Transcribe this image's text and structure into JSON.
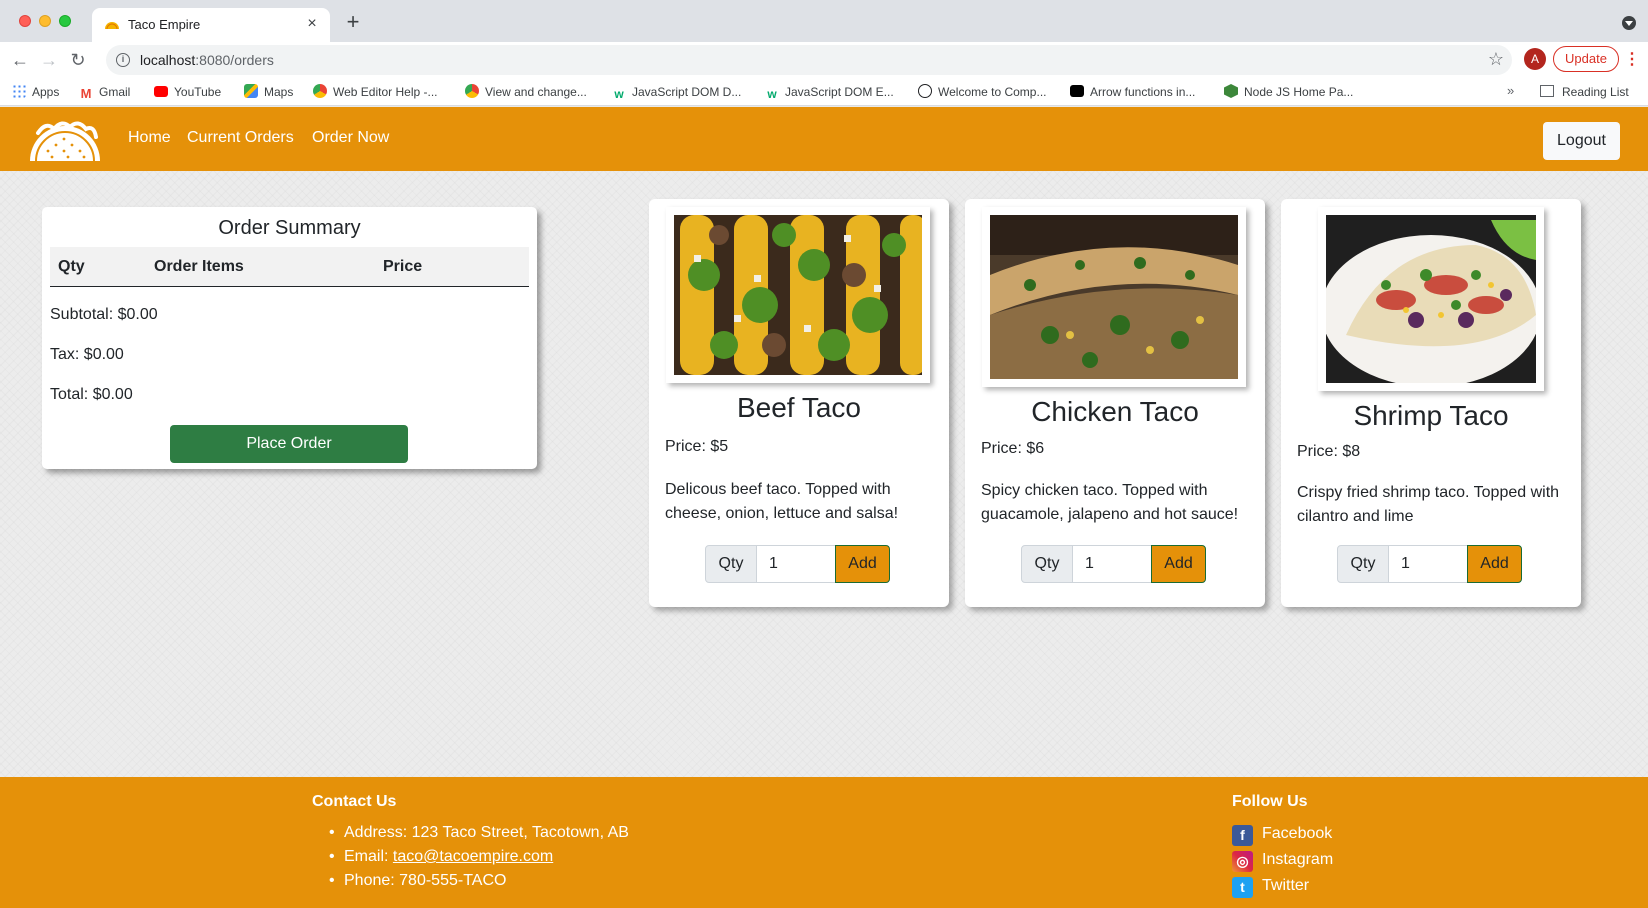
{
  "browser": {
    "tab_title": "Taco Empire",
    "url_host": "localhost",
    "url_rest": ":8080/orders",
    "profile_initial": "A",
    "update_label": "Update",
    "bookmarks": [
      {
        "label": "Apps",
        "icon": "apps-grid-icon",
        "color": "#4285f4"
      },
      {
        "label": "Gmail",
        "icon": "gmail-icon",
        "color": "#ea4335"
      },
      {
        "label": "YouTube",
        "icon": "youtube-icon",
        "color": "#ff0000"
      },
      {
        "label": "Maps",
        "icon": "maps-icon",
        "color": "#34a853"
      },
      {
        "label": "Web Editor Help -...",
        "icon": "chrome-icon",
        "color": "#fbbc05"
      },
      {
        "label": "View and change...",
        "icon": "chrome-icon",
        "color": "#fbbc05"
      },
      {
        "label": "JavaScript DOM D...",
        "icon": "w3-icon",
        "color": "#04aa6d"
      },
      {
        "label": "JavaScript DOM E...",
        "icon": "w3-icon",
        "color": "#04aa6d"
      },
      {
        "label": "Welcome to Comp...",
        "icon": "compass-icon",
        "color": "#202124"
      },
      {
        "label": "Arrow functions in...",
        "icon": "medium-icon",
        "color": "#000000"
      },
      {
        "label": "Node JS Home Pa...",
        "icon": "nodejs-icon",
        "color": "#3c873a"
      }
    ],
    "reading_list": "Reading List"
  },
  "navbar": {
    "links": [
      "Home",
      "Current Orders",
      "Order Now"
    ],
    "logout": "Logout",
    "brand_color": "#e59109"
  },
  "summary": {
    "title": "Order Summary",
    "columns": [
      "Qty",
      "Order Items",
      "Price"
    ],
    "subtotal": "Subtotal: $0.00",
    "tax": "Tax: $0.00",
    "total": "Total: $0.00",
    "place_order": "Place Order"
  },
  "menu": [
    {
      "name": "Beef Taco",
      "price": "Price: $5",
      "description": "Delicous beef taco. Topped with cheese, onion, lettuce and salsa!",
      "qty_label": "Qty",
      "qty": "1",
      "add": "Add"
    },
    {
      "name": "Chicken Taco",
      "price": "Price: $6",
      "description": "Spicy chicken taco. Topped with guacamole, jalapeno and hot sauce!",
      "qty_label": "Qty",
      "qty": "1",
      "add": "Add"
    },
    {
      "name": "Shrimp Taco",
      "price": "Price: $8",
      "description": "Crispy fried shrimp taco. Topped with cilantro and lime",
      "qty_label": "Qty",
      "qty": "1",
      "add": "Add"
    }
  ],
  "footer": {
    "contact_title": "Contact Us",
    "address": "Address: 123 Taco Street, Tacotown, AB",
    "email_prefix": "Email: ",
    "email": "taco@tacoempire.com",
    "phone": "Phone: 780-555-TACO",
    "follow_title": "Follow Us",
    "social": [
      {
        "label": "Facebook",
        "icon": "facebook-icon",
        "color": "#3b5998"
      },
      {
        "label": "Instagram",
        "icon": "instagram-icon",
        "color": "#c13584"
      },
      {
        "label": "Twitter",
        "icon": "twitter-icon",
        "color": "#1da1f2"
      }
    ]
  }
}
